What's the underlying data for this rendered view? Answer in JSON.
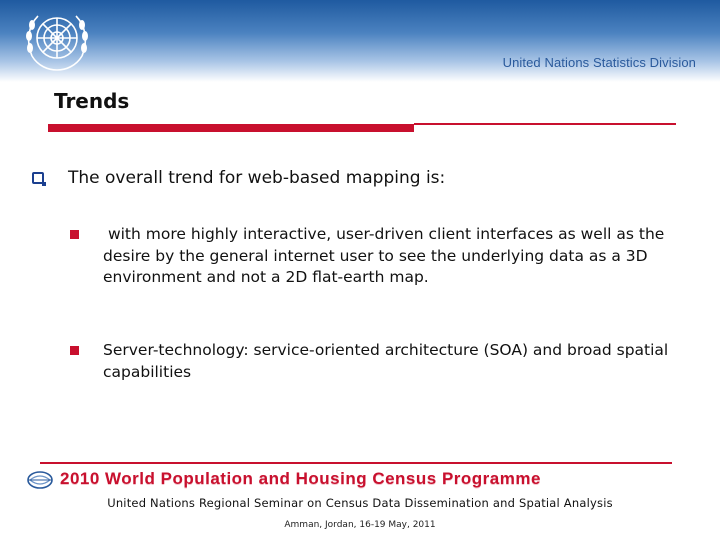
{
  "header": {
    "division": "United Nations Statistics Division",
    "emblem_icon": "un-emblem-icon"
  },
  "slide": {
    "title": "Trends",
    "main_bullet": "The overall trend for web-based mapping is:",
    "sub_bullets": [
      " with more highly interactive, user-driven client interfaces as well as the desire by the general internet user to see the underlying data as a 3D environment and not a 2D flat-earth map.",
      "Server-technology: service-oriented architecture (SOA) and broad spatial capabilities"
    ]
  },
  "footer": {
    "programme": "2010 World Population and Housing Census Programme",
    "seminar": "United Nations Regional Seminar on Census Data Dissemination and Spatial Analysis",
    "location": "Amman, Jordan, 16-19 May, 2011"
  },
  "colors": {
    "accent_red": "#c8102e",
    "header_blue": "#1f5aa0",
    "bullet_blue": "#1b3f8f"
  }
}
